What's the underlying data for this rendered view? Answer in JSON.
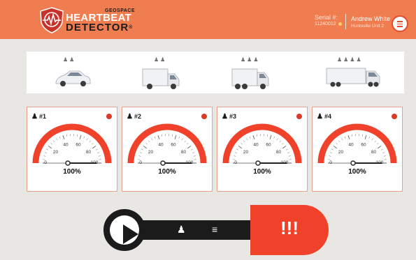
{
  "brand": {
    "top_word": "GEOSPACE",
    "line1": "HEARTBEAT",
    "line2": "DETECTOR",
    "mark": "®"
  },
  "device": {
    "serial_label": "Serial #:",
    "serial_value": "11240012"
  },
  "user": {
    "name": "Andrew White",
    "unit": "Huntsville Unit 2"
  },
  "vehicles": [
    {
      "type": "car",
      "occupants": 2,
      "people": "♟♟"
    },
    {
      "type": "box-truck",
      "occupants": 2,
      "people": "♟♟"
    },
    {
      "type": "medium-truck",
      "occupants": 3,
      "people": "♟♟♟"
    },
    {
      "type": "semi-trailer",
      "occupants": 4,
      "people": "♟♟♟♟"
    }
  ],
  "sensors": [
    {
      "label": "#1",
      "percent_text": "100%",
      "value": 100
    },
    {
      "label": "#2",
      "percent_text": "100%",
      "value": 100
    },
    {
      "label": "#3",
      "percent_text": "100%",
      "value": 100
    },
    {
      "label": "#4",
      "percent_text": "100%",
      "value": 100
    }
  ],
  "gauge_ticks": [
    "0",
    "20",
    "40",
    "60",
    "80",
    "100"
  ],
  "controls": {
    "alert_label": "!!!",
    "person_icon": "♟",
    "doc_icon": "≡"
  },
  "colors": {
    "header": "#f07d50",
    "accent": "#f0412b",
    "gauge_arc": "#f0412b",
    "card_border": "#e7a08a",
    "record_dot": "#d83a25"
  }
}
